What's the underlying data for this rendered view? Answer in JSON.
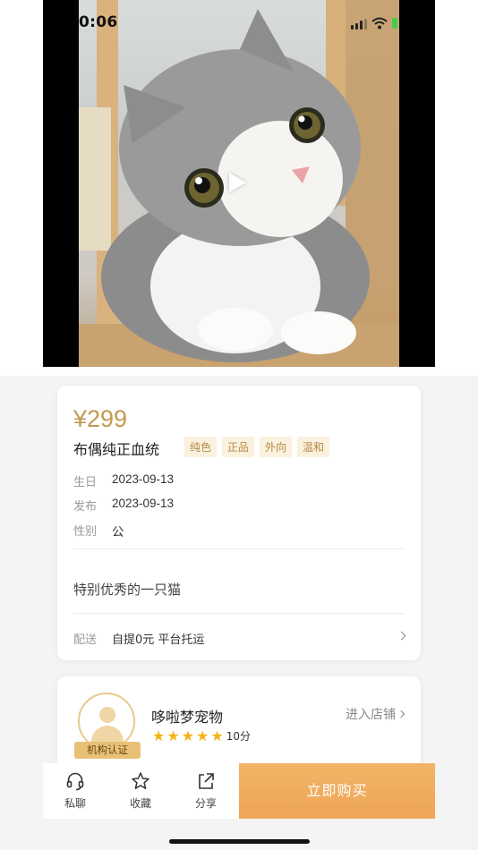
{
  "status_bar": {
    "time": "0:06"
  },
  "media": {
    "description_icon": "play-icon"
  },
  "product": {
    "price": "¥299",
    "title": "布偶纯正血统",
    "tags": [
      "纯色",
      "正品",
      "外向",
      "温和"
    ],
    "info": [
      {
        "label": "生日",
        "value": "2023-09-13"
      },
      {
        "label": "发布",
        "value": "2023-09-13"
      },
      {
        "label": "性别",
        "value": "公"
      }
    ],
    "description": "特别优秀的一只猫",
    "delivery": {
      "label": "配送",
      "value": "自提0元 平台托运"
    }
  },
  "store": {
    "name": "哆啦梦宠物",
    "badge": "机构认证",
    "rating_stars": 5,
    "score": "10分",
    "enter_label": "进入店铺"
  },
  "bottom_bar": {
    "chat_label": "私聊",
    "favorite_label": "收藏",
    "share_label": "分享",
    "buy_label": "立即购买"
  },
  "colors": {
    "price": "#c19a52",
    "tag_bg": "#fbf1df",
    "buy_button": "#eea557",
    "star": "#f5b315"
  }
}
